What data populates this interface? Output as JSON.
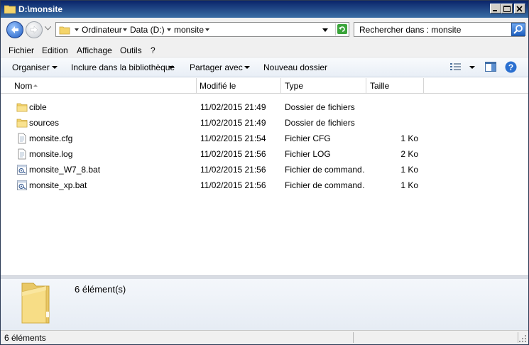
{
  "window": {
    "title": "D:\\monsite"
  },
  "address": {
    "crumbs": [
      "Ordinateur",
      "Data (D:)",
      "monsite"
    ],
    "search_placeholder": "Rechercher dans : monsite"
  },
  "menu": [
    "Fichier",
    "Edition",
    "Affichage",
    "Outils",
    "?"
  ],
  "commands": {
    "organize": "Organiser",
    "include": "Inclure dans la bibliothèque",
    "share": "Partager avec",
    "new_folder": "Nouveau dossier"
  },
  "columns": {
    "name": "Nom",
    "modified": "Modifié le",
    "type": "Type",
    "size": "Taille"
  },
  "files": [
    {
      "name": "cible",
      "modified": "11/02/2015 21:49",
      "type": "Dossier de fichiers",
      "size": "",
      "icon": "folder-icon"
    },
    {
      "name": "sources",
      "modified": "11/02/2015 21:49",
      "type": "Dossier de fichiers",
      "size": "",
      "icon": "folder-icon"
    },
    {
      "name": "monsite.cfg",
      "modified": "11/02/2015 21:54",
      "type": "Fichier CFG",
      "size": "1 Ko",
      "icon": "document-icon"
    },
    {
      "name": "monsite.log",
      "modified": "11/02/2015 21:56",
      "type": "Fichier LOG",
      "size": "2 Ko",
      "icon": "document-icon"
    },
    {
      "name": "monsite_W7_8.bat",
      "modified": "11/02/2015 21:56",
      "type": "Fichier de command…",
      "size": "1 Ko",
      "icon": "batch-file-icon"
    },
    {
      "name": "monsite_xp.bat",
      "modified": "11/02/2015 21:56",
      "type": "Fichier de command…",
      "size": "1 Ko",
      "icon": "batch-file-icon"
    }
  ],
  "details": {
    "count": "6 élément(s)"
  },
  "status": {
    "text": "6 éléments"
  }
}
